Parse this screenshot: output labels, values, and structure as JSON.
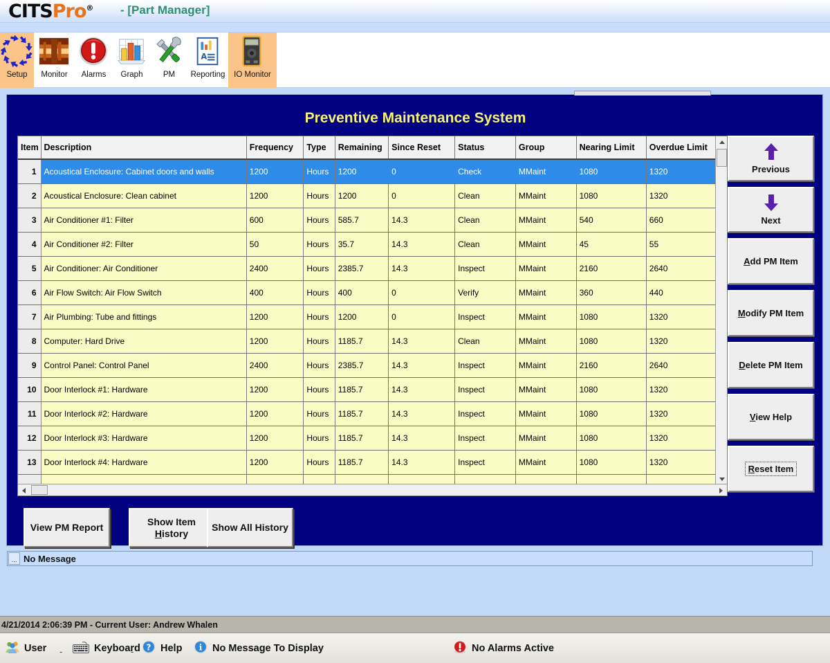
{
  "window": {
    "brand_cits": "CITS",
    "brand_pro": "Pro",
    "brand_reg": "®",
    "doc_title": "- [Part Manager]"
  },
  "toolbar": {
    "items": [
      {
        "label": "Setup",
        "icon": "recycle-arrows-icon",
        "selected": true
      },
      {
        "label": "Monitor",
        "icon": "furnace-monitor-icon",
        "selected": false
      },
      {
        "label": "Alarms",
        "icon": "alarm-exclamation-icon",
        "selected": false
      },
      {
        "label": "Graph",
        "icon": "bar-chart-icon",
        "selected": false
      },
      {
        "label": "PM",
        "icon": "wrench-screwdriver-icon",
        "selected": false
      },
      {
        "label": "Reporting",
        "icon": "report-document-icon",
        "selected": false
      },
      {
        "label": "IO Monitor",
        "icon": "multimeter-icon",
        "selected": true
      }
    ]
  },
  "panel": {
    "title": "Preventive Maintenance System",
    "accent_bg": "#000080",
    "title_color": "#F6F374"
  },
  "grid": {
    "columns": [
      {
        "key": "item",
        "label": "Item"
      },
      {
        "key": "desc",
        "label": "Description"
      },
      {
        "key": "freq",
        "label": "Frequency"
      },
      {
        "key": "type",
        "label": "Type"
      },
      {
        "key": "rem",
        "label": "Remaining"
      },
      {
        "key": "since",
        "label": "Since Reset"
      },
      {
        "key": "status",
        "label": "Status"
      },
      {
        "key": "group",
        "label": "Group"
      },
      {
        "key": "nearing",
        "label": "Nearing Limit"
      },
      {
        "key": "overdue",
        "label": "Overdue Limit"
      }
    ],
    "selected_row_color": "#2E8CE8",
    "row_color": "#FBFBC6",
    "rows": [
      {
        "item": "1",
        "desc": "Acoustical Enclosure: Cabinet doors and walls",
        "freq": "1200",
        "type": "Hours",
        "rem": "1200",
        "since": "0",
        "status": "Check",
        "group": "MMaint",
        "nearing": "1080",
        "overdue": "1320",
        "selected": true
      },
      {
        "item": "2",
        "desc": "Acoustical Enclosure: Clean cabinet",
        "freq": "1200",
        "type": "Hours",
        "rem": "1200",
        "since": "0",
        "status": "Clean",
        "group": "MMaint",
        "nearing": "1080",
        "overdue": "1320",
        "selected": false
      },
      {
        "item": "3",
        "desc": "Air Conditioner #1: Filter",
        "freq": "600",
        "type": "Hours",
        "rem": "585.7",
        "since": "14.3",
        "status": "Clean",
        "group": "MMaint",
        "nearing": "540",
        "overdue": "660",
        "selected": false
      },
      {
        "item": "4",
        "desc": "Air Conditioner #2: Filter",
        "freq": "50",
        "type": "Hours",
        "rem": "35.7",
        "since": "14.3",
        "status": "Clean",
        "group": "MMaint",
        "nearing": "45",
        "overdue": "55",
        "selected": false
      },
      {
        "item": "5",
        "desc": "Air Conditioner: Air Conditioner",
        "freq": "2400",
        "type": "Hours",
        "rem": "2385.7",
        "since": "14.3",
        "status": "Inspect",
        "group": "MMaint",
        "nearing": "2160",
        "overdue": "2640",
        "selected": false
      },
      {
        "item": "6",
        "desc": "Air Flow Switch: Air Flow Switch",
        "freq": "400",
        "type": "Hours",
        "rem": "400",
        "since": "0",
        "status": "Verify",
        "group": "MMaint",
        "nearing": "360",
        "overdue": "440",
        "selected": false
      },
      {
        "item": "7",
        "desc": "Air Plumbing: Tube and fittings",
        "freq": "1200",
        "type": "Hours",
        "rem": "1200",
        "since": "0",
        "status": "Inspect",
        "group": "MMaint",
        "nearing": "1080",
        "overdue": "1320",
        "selected": false
      },
      {
        "item": "8",
        "desc": "Computer: Hard Drive",
        "freq": "1200",
        "type": "Hours",
        "rem": "1185.7",
        "since": "14.3",
        "status": "Clean",
        "group": "MMaint",
        "nearing": "1080",
        "overdue": "1320",
        "selected": false
      },
      {
        "item": "9",
        "desc": "Control Panel: Control Panel",
        "freq": "2400",
        "type": "Hours",
        "rem": "2385.7",
        "since": "14.3",
        "status": "Inspect",
        "group": "MMaint",
        "nearing": "2160",
        "overdue": "2640",
        "selected": false
      },
      {
        "item": "10",
        "desc": "Door Interlock #1: Hardware",
        "freq": "1200",
        "type": "Hours",
        "rem": "1185.7",
        "since": "14.3",
        "status": "Inspect",
        "group": "MMaint",
        "nearing": "1080",
        "overdue": "1320",
        "selected": false
      },
      {
        "item": "11",
        "desc": "Door Interlock #2: Hardware",
        "freq": "1200",
        "type": "Hours",
        "rem": "1185.7",
        "since": "14.3",
        "status": "Inspect",
        "group": "MMaint",
        "nearing": "1080",
        "overdue": "1320",
        "selected": false
      },
      {
        "item": "12",
        "desc": "Door Interlock #3: Hardware",
        "freq": "1200",
        "type": "Hours",
        "rem": "1185.7",
        "since": "14.3",
        "status": "Inspect",
        "group": "MMaint",
        "nearing": "1080",
        "overdue": "1320",
        "selected": false
      },
      {
        "item": "13",
        "desc": "Door Interlock #4: Hardware",
        "freq": "1200",
        "type": "Hours",
        "rem": "1185.7",
        "since": "14.3",
        "status": "Inspect",
        "group": "MMaint",
        "nearing": "1080",
        "overdue": "1320",
        "selected": false
      },
      {
        "item": "",
        "desc": "",
        "freq": "",
        "type": "",
        "rem": "",
        "since": "",
        "status": "",
        "group": "",
        "nearing": "",
        "overdue": "",
        "selected": false
      }
    ]
  },
  "side_buttons": [
    {
      "id": "previous",
      "label": "Previous",
      "icon": "arrow-up-icon",
      "underline": "",
      "kind": "nav"
    },
    {
      "id": "next",
      "label": "Next",
      "icon": "arrow-down-icon",
      "underline": "",
      "kind": "nav"
    },
    {
      "id": "add-pm",
      "label": "Add PM Item",
      "icon": "",
      "underline": "A",
      "kind": "act"
    },
    {
      "id": "modify-pm",
      "label": "Modify PM Item",
      "icon": "",
      "underline": "M",
      "kind": "act"
    },
    {
      "id": "delete-pm",
      "label": "Delete PM Item",
      "icon": "",
      "underline": "D",
      "kind": "act"
    },
    {
      "id": "view-help",
      "label": "View Help",
      "icon": "",
      "underline": "V",
      "kind": "act"
    },
    {
      "id": "reset-item",
      "label": "Reset Item",
      "icon": "",
      "underline": "R",
      "kind": "act",
      "focused": true
    }
  ],
  "bottom_buttons": [
    {
      "id": "view-pm-report",
      "line1": "View PM Report",
      "line2": "",
      "underline": ""
    },
    {
      "id": "show-item-history",
      "line1": "Show Item",
      "line2": "History",
      "underline": "H"
    },
    {
      "id": "show-all-history",
      "line1": "Show All History",
      "line2": "",
      "underline": ""
    }
  ],
  "message_box": {
    "dots": "...",
    "text": "No Message"
  },
  "status": {
    "user_line": "4/21/2014 2:06:39 PM - Current User:  Andrew Whalen",
    "items": [
      {
        "id": "user",
        "label": "User",
        "icon": "users-icon"
      },
      {
        "id": "keyboard",
        "label": "Keyboard",
        "icon": "keyboard-icon"
      },
      {
        "id": "help",
        "label": "Help",
        "icon": "help-question-icon"
      },
      {
        "id": "message",
        "label": "No Message To Display",
        "icon": "info-icon"
      },
      {
        "id": "alarms",
        "label": "No Alarms Active",
        "icon": "alarm-red-icon"
      }
    ],
    "separator": "-"
  }
}
